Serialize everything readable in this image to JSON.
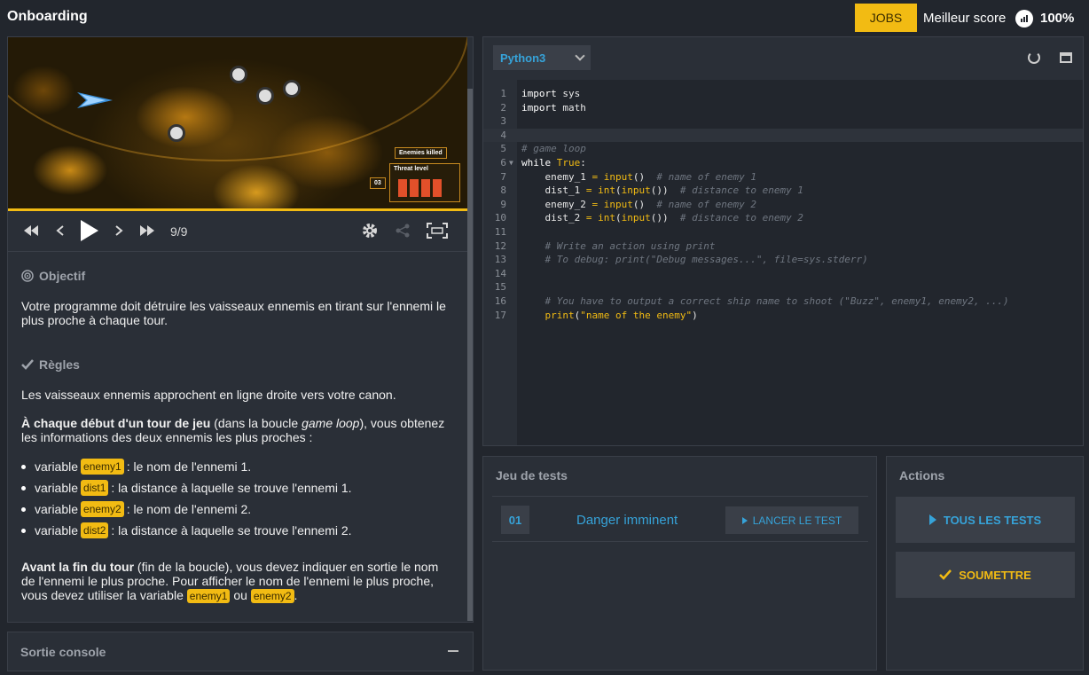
{
  "header": {
    "title": "Onboarding",
    "jobs_label": "JOBS",
    "best_score_label": "Meilleur score",
    "best_score_value": "100%"
  },
  "viewer": {
    "frame": "9/9",
    "hud": {
      "enemies_killed": "Enemies killed",
      "threat_level": "Threat level",
      "threat_value": "03"
    },
    "progress_fraction": 1.0
  },
  "statement": {
    "objective_title": "Objectif",
    "objective_text": "Votre programme doit détruire les vaisseaux ennemis en tirant sur l'ennemi le plus proche à chaque tour.",
    "rules_title": "Règles",
    "rules_intro": "Les vaisseaux ennemis approchent en ligne droite vers votre canon.",
    "turn_start_bold": "À chaque début d'un tour de jeu",
    "turn_start_paren_a": " (dans la boucle ",
    "turn_start_italic": "game loop",
    "turn_start_paren_b": "), vous obtenez les informations des deux ennemis les plus proches :",
    "bullets": [
      {
        "prefix": "variable",
        "var": "enemy1",
        "text": ": le nom de l'ennemi 1."
      },
      {
        "prefix": "variable",
        "var": "dist1",
        "text": ": la distance à laquelle se trouve l'ennemi 1."
      },
      {
        "prefix": "variable",
        "var": "enemy2",
        "text": ": le nom de l'ennemi 2."
      },
      {
        "prefix": "variable",
        "var": "dist2",
        "text": ": la distance à laquelle se trouve l'ennemi 2."
      }
    ],
    "end_bold": "Avant la fin du tour",
    "end_text": " (fin de la boucle), vous devez indiquer en sortie le nom de l'ennemi le plus proche. Pour afficher le nom de l'ennemi le plus proche, vous devez utiliser la variable ",
    "end_var1": "enemy1",
    "end_or": " ou ",
    "end_var2": "enemy2",
    "end_dot": "."
  },
  "console": {
    "title": "Sortie console"
  },
  "editor": {
    "language": "Python3",
    "lines": [
      {
        "n": "1",
        "code": "import sys"
      },
      {
        "n": "2",
        "code": "import math"
      },
      {
        "n": "3",
        "code": ""
      },
      {
        "n": "4",
        "code": ""
      },
      {
        "n": "5",
        "code": "# game loop"
      },
      {
        "n": "6",
        "code": "while True:"
      },
      {
        "n": "7",
        "code": "    enemy_1 = input()  # name of enemy 1"
      },
      {
        "n": "8",
        "code": "    dist_1 = int(input())  # distance to enemy 1"
      },
      {
        "n": "9",
        "code": "    enemy_2 = input()  # name of enemy 2"
      },
      {
        "n": "10",
        "code": "    dist_2 = int(input())  # distance to enemy 2"
      },
      {
        "n": "11",
        "code": ""
      },
      {
        "n": "12",
        "code": "    # Write an action using print"
      },
      {
        "n": "13",
        "code": "    # To debug: print(\"Debug messages...\", file=sys.stderr)"
      },
      {
        "n": "14",
        "code": ""
      },
      {
        "n": "15",
        "code": ""
      },
      {
        "n": "16",
        "code": "    # You have to output a correct ship name to shoot (\"Buzz\", enemy1, enemy2, ...)"
      },
      {
        "n": "17",
        "code": "    print(\"name of the enemy\")"
      }
    ],
    "active_line": "4",
    "folded_line": "6"
  },
  "tests": {
    "title": "Jeu de tests",
    "items": [
      {
        "num": "01",
        "name": "Danger imminent",
        "run_label": "LANCER LE TEST"
      }
    ]
  },
  "actions": {
    "title": "Actions",
    "run_all_label": "TOUS LES TESTS",
    "submit_label": "SOUMETTRE"
  },
  "colors": {
    "accent": "#f2bb13",
    "link": "#36a3d9",
    "background": "#22262d",
    "panel": "#2a2f37"
  }
}
